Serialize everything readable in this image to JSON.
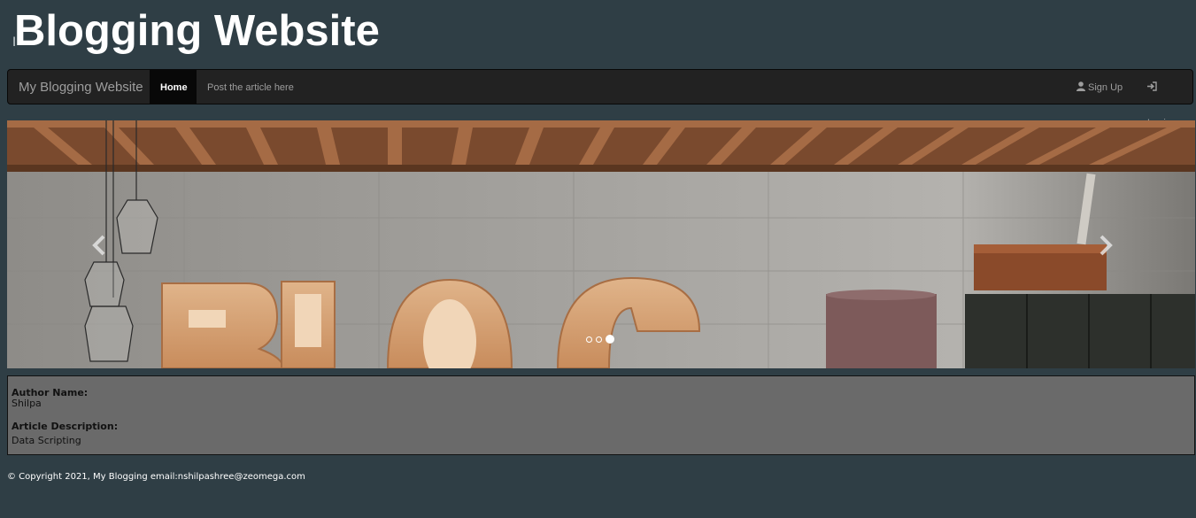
{
  "header": {
    "title": "Blogging Website"
  },
  "navbar": {
    "brand": "My Blogging Website",
    "home": "Home",
    "post": "Post the article here",
    "signup": "Sign Up",
    "login": "Login"
  },
  "carousel": {
    "image_text": "BLOG",
    "slide_count": 3,
    "active_slide": 3
  },
  "article": {
    "author_label": "Author Name:",
    "author_value": "Shilpa",
    "description_label": "Article Description:",
    "description_value": "Data Scripting"
  },
  "footer": {
    "text": "© Copyright 2021, My Blogging email:nshilpashree@zeomega.com"
  },
  "colors": {
    "page_bg": "#2f3e45",
    "navbar_bg": "#222222",
    "panel_bg": "#6a6a6a"
  }
}
